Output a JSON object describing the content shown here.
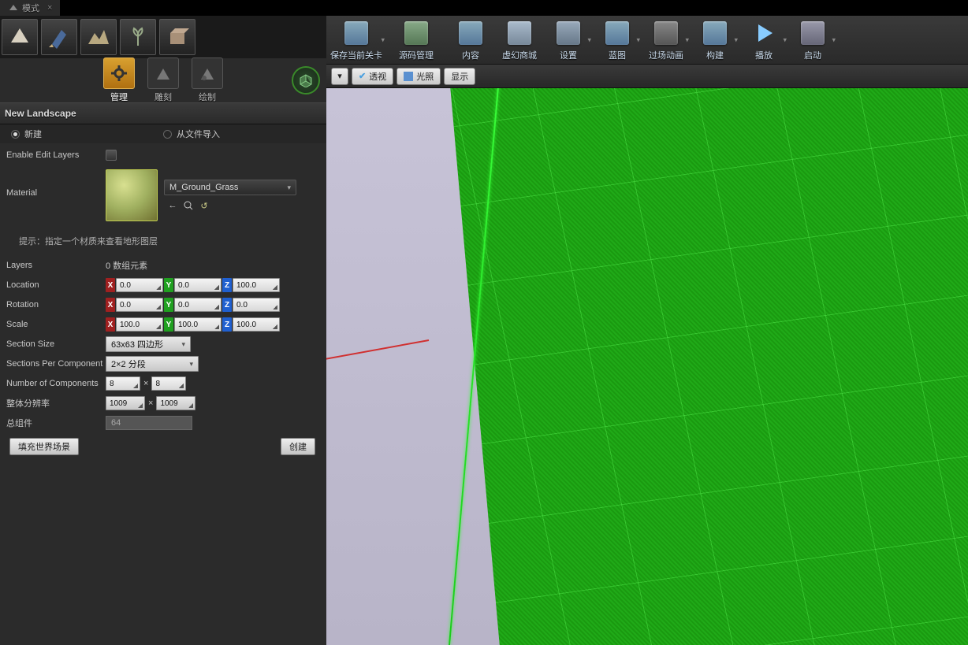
{
  "tab": {
    "title": "模式",
    "close": "×"
  },
  "toolbar": [
    {
      "label": "保存当前关卡",
      "icon": "save"
    },
    {
      "label": "源码管理",
      "icon": "source"
    },
    {
      "label": "内容",
      "icon": "content"
    },
    {
      "label": "虚幻商城",
      "icon": "market"
    },
    {
      "label": "设置",
      "icon": "settings"
    },
    {
      "label": "蓝图",
      "icon": "blueprint"
    },
    {
      "label": "过场动画",
      "icon": "cinematic"
    },
    {
      "label": "构建",
      "icon": "build"
    },
    {
      "label": "播放",
      "icon": "play"
    },
    {
      "label": "启动",
      "icon": "launch"
    }
  ],
  "modeTabs": [
    {
      "label": "管理",
      "active": true
    },
    {
      "label": "雕刻",
      "active": false
    },
    {
      "label": "绘制",
      "active": false
    }
  ],
  "section": {
    "title": "New Landscape"
  },
  "radios": {
    "create": "新建",
    "import": "从文件导入"
  },
  "props": {
    "enableEditLayers": "Enable Edit Layers",
    "material": "Material",
    "materialName": "M_Ground_Grass",
    "hint": "提示：指定一个材质来查看地形图层",
    "layers": "Layers",
    "layersVal": "0 数组元素",
    "location": "Location",
    "rotation": "Rotation",
    "scale": "Scale",
    "loc": {
      "x": "0.0",
      "y": "0.0",
      "z": "100.0"
    },
    "rot": {
      "x": "0.0",
      "y": "0.0",
      "z": "0.0"
    },
    "scl": {
      "x": "100.0",
      "y": "100.0",
      "z": "100.0"
    },
    "sectionSize": "Section Size",
    "sectionSizeVal": "63x63 四边形",
    "sectionsPerComp": "Sections Per Component",
    "sectionsPerCompVal": "2×2 分段",
    "numComponents": "Number of Components",
    "numComp1": "8",
    "numComp2": "8",
    "overallRes": "整体分辨率",
    "res1": "1009",
    "res2": "1009",
    "totalComp": "总组件",
    "totalCompVal": "64"
  },
  "buttons": {
    "fill": "填充世界场景",
    "create": "创建"
  },
  "viewport": {
    "dropdown": "▾",
    "persp": "透视",
    "lit": "光照",
    "show": "显示"
  },
  "multiply": "×"
}
